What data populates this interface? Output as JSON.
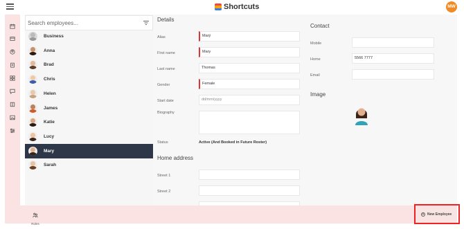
{
  "header": {
    "logo_text": "Shortcuts",
    "user_initials": "MW",
    "logo_colors": [
      "#e94b3c",
      "#f4a21a",
      "#3b7dd8"
    ]
  },
  "rail_icons": [
    "calendar-icon",
    "card-icon",
    "person-circle-icon",
    "clipboard-icon",
    "grid-icon",
    "chat-icon",
    "book-icon",
    "image-icon",
    "sliders-icon"
  ],
  "search": {
    "placeholder": "Search employees..."
  },
  "employees": [
    {
      "name": "Business",
      "selected": false,
      "skin": "#bbb",
      "hair": "#999"
    },
    {
      "name": "Anna",
      "selected": false,
      "skin": "#c9916a",
      "hair": "#2b1a10"
    },
    {
      "name": "Brad",
      "selected": false,
      "skin": "#e4b69a",
      "hair": "#5a3d2b"
    },
    {
      "name": "Chris",
      "selected": false,
      "skin": "#f1c9a6",
      "hair": "#3a5fa8"
    },
    {
      "name": "Helen",
      "selected": false,
      "skin": "#e8c8b0",
      "hair": "#c9a27a"
    },
    {
      "name": "James",
      "selected": false,
      "skin": "#b7825e",
      "hair": "#d45a25"
    },
    {
      "name": "Katie",
      "selected": false,
      "skin": "#d8a683",
      "hair": "#2a1a12"
    },
    {
      "name": "Lucy",
      "selected": false,
      "skin": "#edc3a0",
      "hair": "#3b2416"
    },
    {
      "name": "Mary",
      "selected": true,
      "skin": "#e2b08e",
      "hair": "#3a2418"
    },
    {
      "name": "Sarah",
      "selected": false,
      "skin": "#e9c2a3",
      "hair": "#6b3d22"
    }
  ],
  "details": {
    "title": "Details",
    "alias": {
      "label": "Alias",
      "value": "Marÿ"
    },
    "first_name": {
      "label": "First name",
      "value": "Mary"
    },
    "last_name": {
      "label": "Last name",
      "value": "Thomas"
    },
    "gender": {
      "label": "Gender",
      "value": "Female"
    },
    "start_date": {
      "label": "Start date",
      "placeholder": "dd/mm/yyyy"
    },
    "biography": {
      "label": "Biography",
      "value": ""
    },
    "status": {
      "label": "Status",
      "value": "Active (And Booked in Future Roster)"
    }
  },
  "home_address": {
    "title": "Home address",
    "street1": {
      "label": "Street 1",
      "value": ""
    },
    "street2": {
      "label": "Street 2",
      "value": ""
    }
  },
  "contact": {
    "title": "Contact",
    "mobile": {
      "label": "Mobile",
      "value": ""
    },
    "home": {
      "label": "Home",
      "value": "5566 7777"
    },
    "email": {
      "label": "Email",
      "value": ""
    }
  },
  "image": {
    "title": "Image"
  },
  "footer": {
    "roles_label": "Roles",
    "new_employee_label": "New Employee"
  }
}
